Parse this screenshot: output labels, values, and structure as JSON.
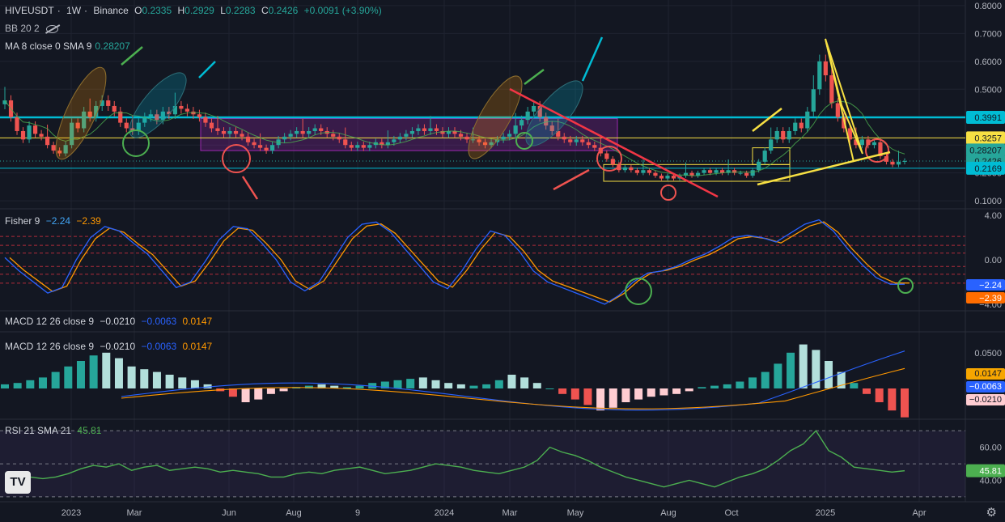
{
  "header": {
    "symbol": "HIVEUSDT",
    "sep1": "·",
    "interval": "1W",
    "sep2": "·",
    "exchange": "Binance",
    "o_label": "O",
    "o_value": "0.2335",
    "h_label": "H",
    "h_value": "0.2929",
    "l_label": "L",
    "l_value": "0.2283",
    "c_label": "C",
    "c_value": "0.2426",
    "change": "+0.0091 (+3.90%)"
  },
  "indicators": {
    "bb": "BB 20 2",
    "ma_label": "MA 8 close 0 SMA 9",
    "ma_value": "0.28207",
    "fisher_label": "Fisher 9",
    "fisher_v1": "−2.24",
    "fisher_v2": "−2.39",
    "macd1_label": "MACD 12 26 close 9",
    "macd1_v1": "−0.0210",
    "macd1_v2": "−0.0063",
    "macd1_v3": "0.0147",
    "macd2_label": "MACD 12 26 close 9",
    "macd2_v1": "−0.0210",
    "macd2_v2": "−0.0063",
    "macd2_v3": "0.0147",
    "rsi_label": "RSI 21 SMA 21",
    "rsi_value": "45.81"
  },
  "logo": "TV",
  "gear_icon": "gear-icon",
  "colors": {
    "up": "#26a69a",
    "down": "#ef5350",
    "bg": "#131722",
    "cyan": "#00bcd4",
    "yellow": "#f7e043",
    "purple": "#9c27b0"
  },
  "chart_data": [
    {
      "type": "candlestick",
      "pane": "price",
      "x_tick_labels": [
        "2023",
        "Mar",
        "Jun",
        "Aug",
        "9",
        "2024",
        "Mar",
        "May",
        "Aug",
        "Oct",
        "2025",
        "Apr"
      ],
      "y_ticks": [
        0.8,
        0.7,
        0.6,
        0.5,
        0.4,
        0.3,
        0.2,
        0.1
      ],
      "y_tick_labels": [
        "0.8000",
        "0.7000",
        "0.6000",
        "0.5000",
        "0.4000",
        "0.3000",
        "0.2000",
        "0.1000"
      ],
      "ylim": [
        0.08,
        0.82
      ],
      "price_labels": [
        {
          "value": 0.3991,
          "text": "0.3991",
          "color": "#00bcd4"
        },
        {
          "value": 0.3257,
          "text": "0.3257",
          "color": "#f7e043"
        },
        {
          "value": 0.28207,
          "text": "0.28207",
          "color": "#26a69a"
        },
        {
          "value": 0.2426,
          "text": "0.2426",
          "color": "#26a69a"
        },
        {
          "value": 0.2169,
          "text": "0.2169",
          "color": "#00bcd4"
        }
      ],
      "closes": [
        0.46,
        0.4,
        0.35,
        0.32,
        0.37,
        0.34,
        0.33,
        0.3,
        0.28,
        0.27,
        0.3,
        0.38,
        0.36,
        0.42,
        0.4,
        0.44,
        0.46,
        0.44,
        0.42,
        0.38,
        0.36,
        0.35,
        0.38,
        0.4,
        0.41,
        0.39,
        0.42,
        0.41,
        0.44,
        0.43,
        0.42,
        0.41,
        0.4,
        0.38,
        0.36,
        0.35,
        0.34,
        0.35,
        0.34,
        0.33,
        0.31,
        0.3,
        0.29,
        0.28,
        0.3,
        0.32,
        0.33,
        0.34,
        0.35,
        0.34,
        0.35,
        0.36,
        0.35,
        0.34,
        0.33,
        0.32,
        0.3,
        0.29,
        0.3,
        0.29,
        0.3,
        0.31,
        0.3,
        0.31,
        0.32,
        0.33,
        0.34,
        0.35,
        0.36,
        0.35,
        0.36,
        0.35,
        0.34,
        0.35,
        0.34,
        0.33,
        0.32,
        0.32,
        0.31,
        0.3,
        0.31,
        0.32,
        0.33,
        0.34,
        0.37,
        0.39,
        0.42,
        0.44,
        0.4,
        0.37,
        0.35,
        0.33,
        0.32,
        0.31,
        0.32,
        0.31,
        0.3,
        0.29,
        0.27,
        0.25,
        0.23,
        0.21,
        0.22,
        0.21,
        0.2,
        0.21,
        0.2,
        0.19,
        0.18,
        0.19,
        0.18,
        0.19,
        0.2,
        0.19,
        0.2,
        0.21,
        0.2,
        0.21,
        0.2,
        0.21,
        0.2,
        0.2,
        0.19,
        0.21,
        0.24,
        0.28,
        0.32,
        0.35,
        0.32,
        0.35,
        0.38,
        0.36,
        0.42,
        0.5,
        0.6,
        0.55,
        0.45,
        0.4,
        0.36,
        0.32,
        0.3,
        0.32,
        0.3,
        0.31,
        0.26,
        0.24,
        0.23,
        0.24,
        0.2426
      ]
    },
    {
      "type": "line",
      "pane": "fisher",
      "series_labels": [
        "−2.24",
        "−2.39"
      ],
      "y_tick_labels": [
        "4.00",
        "0.00",
        "−4.00"
      ],
      "y_ticks": [
        4,
        0,
        -4
      ],
      "ylim": [
        -4.3,
        4.3
      ]
    },
    {
      "type": "histogram",
      "pane": "macd",
      "y_tick_labels": [
        "0.0500",
        "0.0147",
        "−0.0063",
        "−0.0210"
      ],
      "y_ticks": [
        0.05,
        0.0147,
        -0.0063,
        -0.021
      ]
    },
    {
      "type": "line",
      "pane": "rsi",
      "y_tick_labels": [
        "60.00",
        "45.81",
        "40.00"
      ],
      "y_ticks": [
        60,
        45.81,
        40
      ],
      "ylim": [
        28,
        75
      ]
    }
  ]
}
